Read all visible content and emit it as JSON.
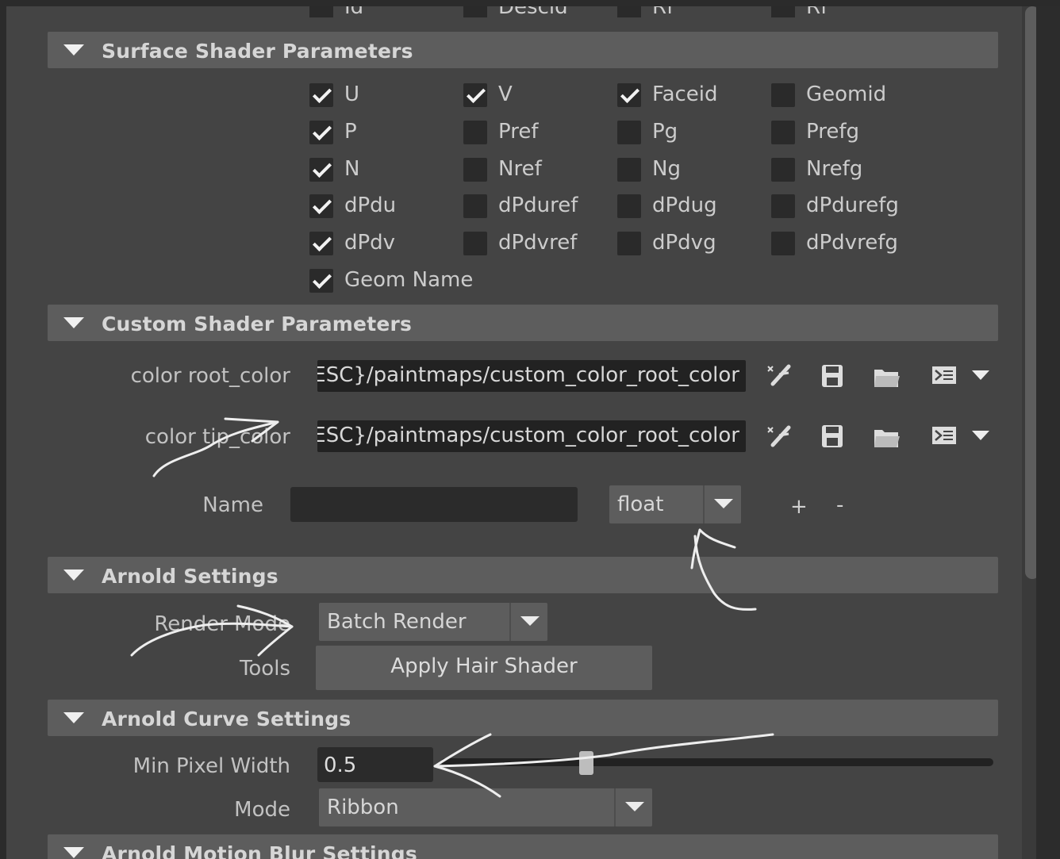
{
  "top_partial_row": [
    "Id",
    "Descid",
    "Rf",
    "Rf"
  ],
  "sections": {
    "surface": {
      "title": "Surface Shader Parameters"
    },
    "custom": {
      "title": "Custom Shader Parameters"
    },
    "arnold": {
      "title": "Arnold Settings"
    },
    "arnold_curve": {
      "title": "Arnold Curve Settings"
    },
    "arnold_motion": {
      "title": "Arnold Motion Blur Settings"
    }
  },
  "surface_checkboxes": [
    [
      {
        "label": "U",
        "checked": true
      },
      {
        "label": "V",
        "checked": true
      },
      {
        "label": "Faceid",
        "checked": true
      },
      {
        "label": "Geomid",
        "checked": false
      }
    ],
    [
      {
        "label": "P",
        "checked": true
      },
      {
        "label": "Pref",
        "checked": false
      },
      {
        "label": "Pg",
        "checked": false
      },
      {
        "label": "Prefg",
        "checked": false
      }
    ],
    [
      {
        "label": "N",
        "checked": true
      },
      {
        "label": "Nref",
        "checked": false
      },
      {
        "label": "Ng",
        "checked": false
      },
      {
        "label": "Nrefg",
        "checked": false
      }
    ],
    [
      {
        "label": "dPdu",
        "checked": true
      },
      {
        "label": "dPduref",
        "checked": false
      },
      {
        "label": "dPdug",
        "checked": false
      },
      {
        "label": "dPdurefg",
        "checked": false
      }
    ],
    [
      {
        "label": "dPdv",
        "checked": true
      },
      {
        "label": "dPdvref",
        "checked": false
      },
      {
        "label": "dPdvg",
        "checked": false
      },
      {
        "label": "dPdvrefg",
        "checked": false
      }
    ],
    [
      {
        "label": "Geom Name",
        "checked": true
      }
    ]
  ],
  "custom": {
    "root_label": "color root_color",
    "root_value": "DESC}/paintmaps/custom_color_root_color",
    "tip_label": "color tip_color",
    "tip_value": "DESC}/paintmaps/custom_color_root_color",
    "name_label": "Name",
    "name_value": "",
    "type_value": "float",
    "add_label": "+",
    "remove_label": "-"
  },
  "arnold": {
    "render_mode_label": "Render Mode",
    "render_mode_value": "Batch Render",
    "tools_label": "Tools",
    "apply_button": "Apply Hair Shader"
  },
  "arnold_curve": {
    "min_pixel_label": "Min Pixel Width",
    "min_pixel_value": "0.5",
    "mode_label": "Mode",
    "mode_value": "Ribbon"
  },
  "icons": [
    "paint-brush-icon",
    "save-icon",
    "folder-open-icon",
    "script-icon",
    "dropdown-arrow-icon"
  ],
  "colors": {
    "panel": "#444444",
    "header": "#5d5d5d",
    "field": "#2b2b2b"
  }
}
